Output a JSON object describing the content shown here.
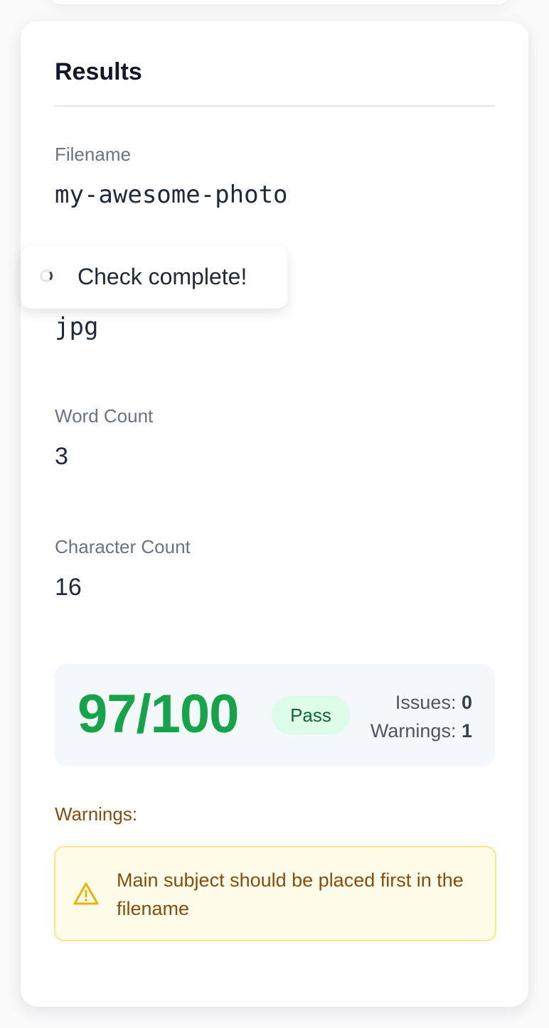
{
  "results": {
    "title": "Results",
    "fields": {
      "filename": {
        "label": "Filename",
        "value": "my-awesome-photo"
      },
      "extension": {
        "value": "jpg"
      },
      "word_count": {
        "label": "Word Count",
        "value": "3"
      },
      "character_count": {
        "label": "Character Count",
        "value": "16"
      }
    }
  },
  "toast": {
    "message": "Check complete!"
  },
  "score": {
    "value": "97/100",
    "status": "Pass",
    "issues_label": "Issues:",
    "issues_count": "0",
    "warnings_label": "Warnings:",
    "warnings_count": "1"
  },
  "warnings": {
    "heading": "Warnings:",
    "items": [
      {
        "text": "Main subject should be placed first in the filename"
      }
    ]
  },
  "colors": {
    "pass": "#16a34a",
    "pass_badge_bg": "#dcfce7",
    "warning_text": "#854d0e",
    "warning_bg": "#fefce8",
    "warning_border": "#fde68a",
    "warning_icon": "#eab308"
  },
  "icons": {
    "toast": "spinner-icon",
    "warning": "warning-triangle-icon"
  }
}
